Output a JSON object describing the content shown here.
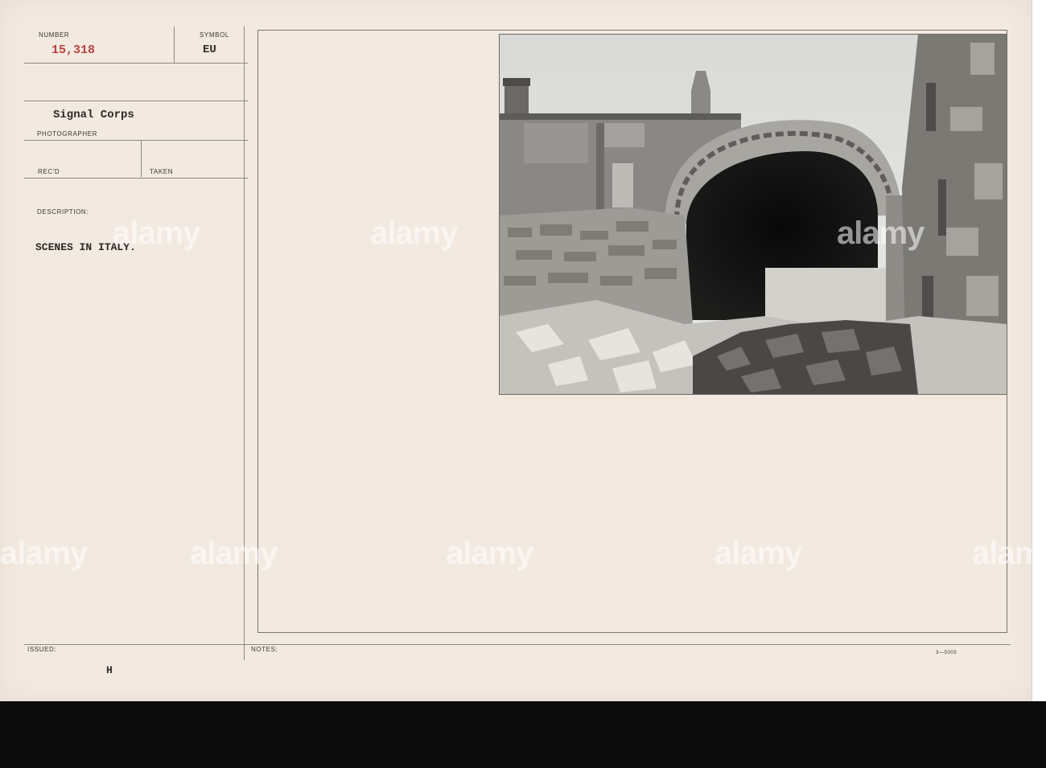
{
  "record": {
    "number_label": "NUMBER",
    "number_value": "15,318",
    "symbol_label": "SYMBOL",
    "symbol_value": "EU",
    "agency": "Signal Corps",
    "photographer_label": "PHOTOGRAPHER",
    "recd_label": "REC'D",
    "taken_label": "TAKEN",
    "description_label": "DESCRIPTION:",
    "description_value": "SCENES IN ITALY.",
    "issued_label": "ISSUED:",
    "issued_value": "H",
    "notes_label": "NOTES:",
    "form_number": "3—5005"
  },
  "photo": {
    "negative_number": "15318"
  },
  "watermark": {
    "text": "alamy"
  },
  "colors": {
    "card": "#f2e9e0",
    "ink": "#2c2a27",
    "number_red": "#b8433e",
    "rule": "#8e8880",
    "strip": "#0c0c0c"
  }
}
